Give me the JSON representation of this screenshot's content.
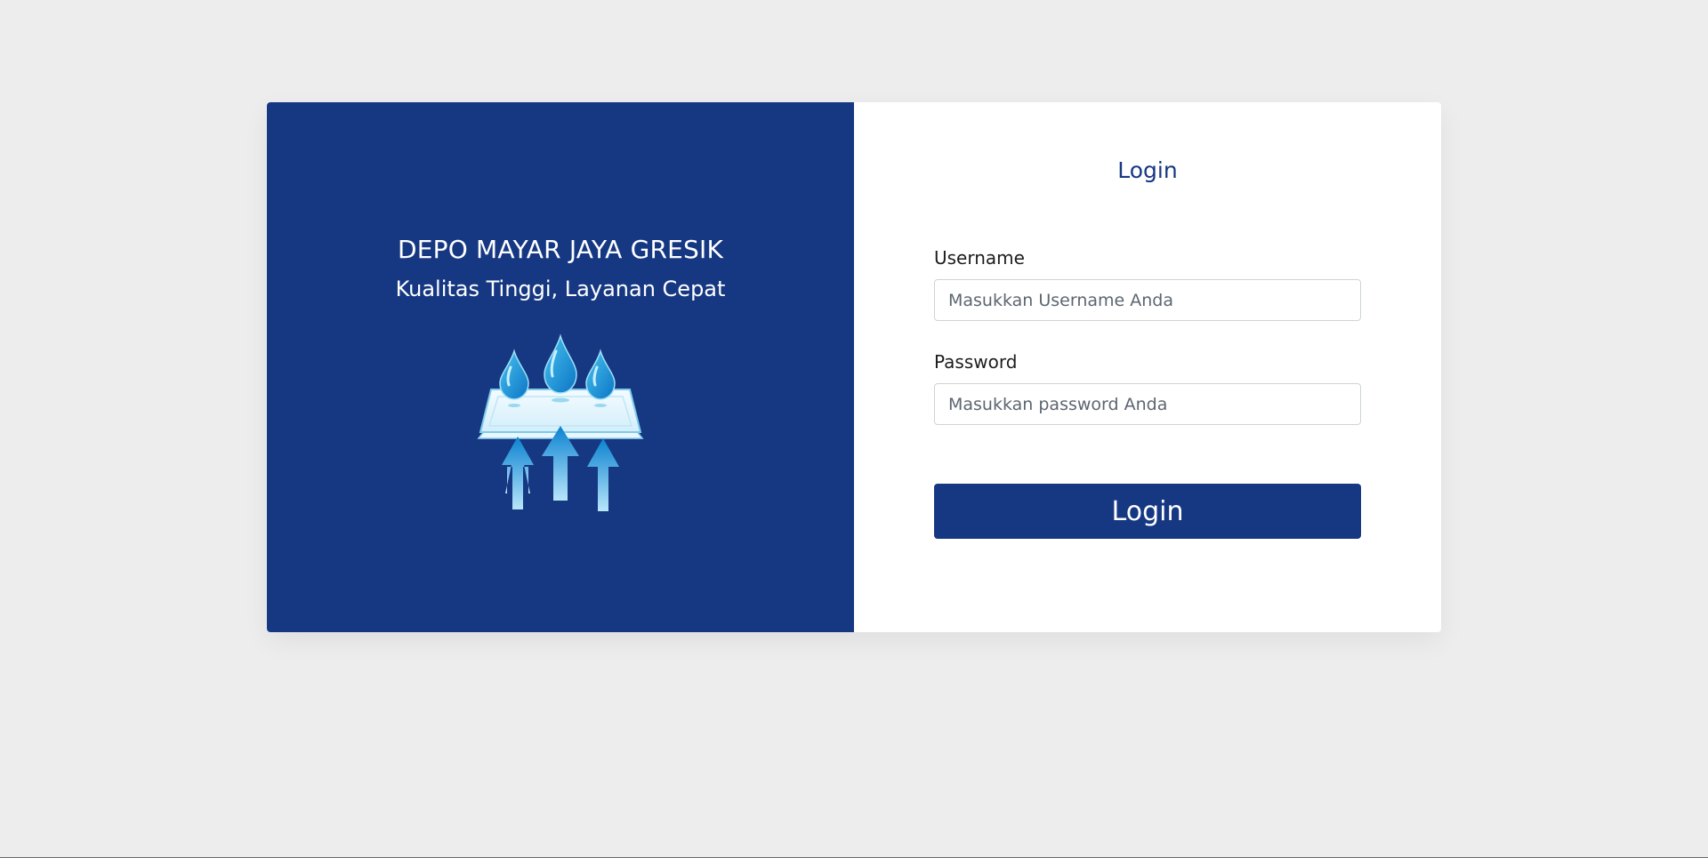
{
  "brand": {
    "title": "DEPO MAYAR JAYA GRESIK",
    "tagline": "Kualitas Tinggi, Layanan Cepat",
    "logo_icon": "water-filter-logo-icon",
    "panel_color": "#163883"
  },
  "login": {
    "heading": "Login",
    "username_label": "Username",
    "username_placeholder": "Masukkan Username Anda",
    "username_value": "",
    "password_label": "Password",
    "password_placeholder": "Masukkan password Anda",
    "password_value": "",
    "button_label": "Login",
    "accent_color": "#163883"
  }
}
